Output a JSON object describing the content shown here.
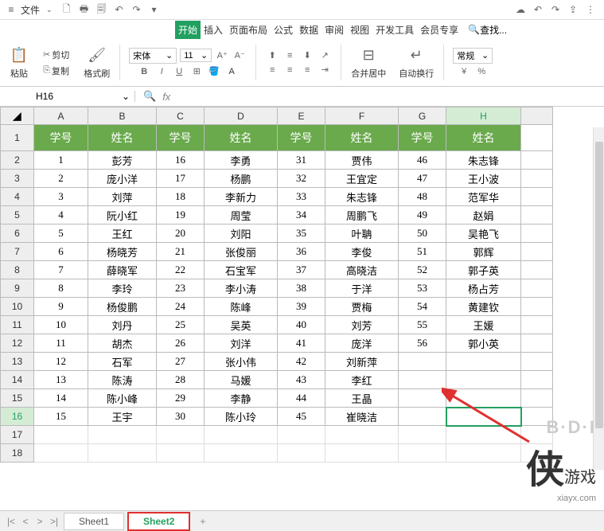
{
  "menubar": {
    "file_label": "文件",
    "search_placeholder": "查找..."
  },
  "tabs": {
    "start": "开始",
    "insert": "插入",
    "page_layout": "页面布局",
    "formulas": "公式",
    "data": "数据",
    "review": "审阅",
    "view": "视图",
    "dev_tools": "开发工具",
    "member": "会员专享"
  },
  "ribbon": {
    "paste": "粘贴",
    "cut": "剪切",
    "copy": "复制",
    "format_painter": "格式刷",
    "font_name": "宋体",
    "font_size": "11",
    "merge_center": "合并居中",
    "auto_wrap": "自动换行",
    "general": "常规"
  },
  "namebox": {
    "cell_ref": "H16"
  },
  "columns": [
    "A",
    "B",
    "C",
    "D",
    "E",
    "F",
    "G",
    "H"
  ],
  "row_numbers": [
    1,
    2,
    3,
    4,
    5,
    6,
    7,
    8,
    9,
    10,
    11,
    12,
    13,
    14,
    15,
    16,
    17,
    18
  ],
  "headers": {
    "id": "学号",
    "name": "姓名"
  },
  "chart_data": {
    "type": "table",
    "columns": [
      "学号",
      "姓名",
      "学号",
      "姓名",
      "学号",
      "姓名",
      "学号",
      "姓名"
    ],
    "rows": [
      [
        "1",
        "彭芳",
        "16",
        "李勇",
        "31",
        "贾伟",
        "46",
        "朱志锋"
      ],
      [
        "2",
        "庞小洋",
        "17",
        "杨鹏",
        "32",
        "王宜定",
        "47",
        "王小波"
      ],
      [
        "3",
        "刘萍",
        "18",
        "李新力",
        "33",
        "朱志锋",
        "48",
        "范军华"
      ],
      [
        "4",
        "阮小红",
        "19",
        "周莹",
        "34",
        "周鹏飞",
        "49",
        "赵娟"
      ],
      [
        "5",
        "王红",
        "20",
        "刘阳",
        "35",
        "叶聃",
        "50",
        "吴艳飞"
      ],
      [
        "6",
        "杨晓芳",
        "21",
        "张俊丽",
        "36",
        "李俊",
        "51",
        "郭辉"
      ],
      [
        "7",
        "薛晓军",
        "22",
        "石宝军",
        "37",
        "高晓洁",
        "52",
        "郭子英"
      ],
      [
        "8",
        "李玲",
        "23",
        "李小涛",
        "38",
        "于洋",
        "53",
        "杨占芳"
      ],
      [
        "9",
        "杨俊鹏",
        "24",
        "陈峰",
        "39",
        "贾梅",
        "54",
        "黄建钦"
      ],
      [
        "10",
        "刘丹",
        "25",
        "吴英",
        "40",
        "刘芳",
        "55",
        "王媛"
      ],
      [
        "11",
        "胡杰",
        "26",
        "刘洋",
        "41",
        "庞洋",
        "56",
        "郭小英"
      ],
      [
        "12",
        "石军",
        "27",
        "张小伟",
        "42",
        "刘新萍",
        "",
        ""
      ],
      [
        "13",
        "陈涛",
        "28",
        "马媛",
        "43",
        "李红",
        "",
        ""
      ],
      [
        "14",
        "陈小峰",
        "29",
        "李静",
        "44",
        "王晶",
        "",
        ""
      ],
      [
        "15",
        "王宇",
        "30",
        "陈小玲",
        "45",
        "崔晓洁",
        "",
        ""
      ]
    ]
  },
  "sheets": {
    "sheet1": "Sheet1",
    "sheet2": "Sheet2"
  },
  "watermark": {
    "logo": "B·D·I",
    "big": "侠",
    "sub": "游戏",
    "url": "xiayx.com"
  },
  "active_cell": {
    "row": 16,
    "col": "H"
  }
}
